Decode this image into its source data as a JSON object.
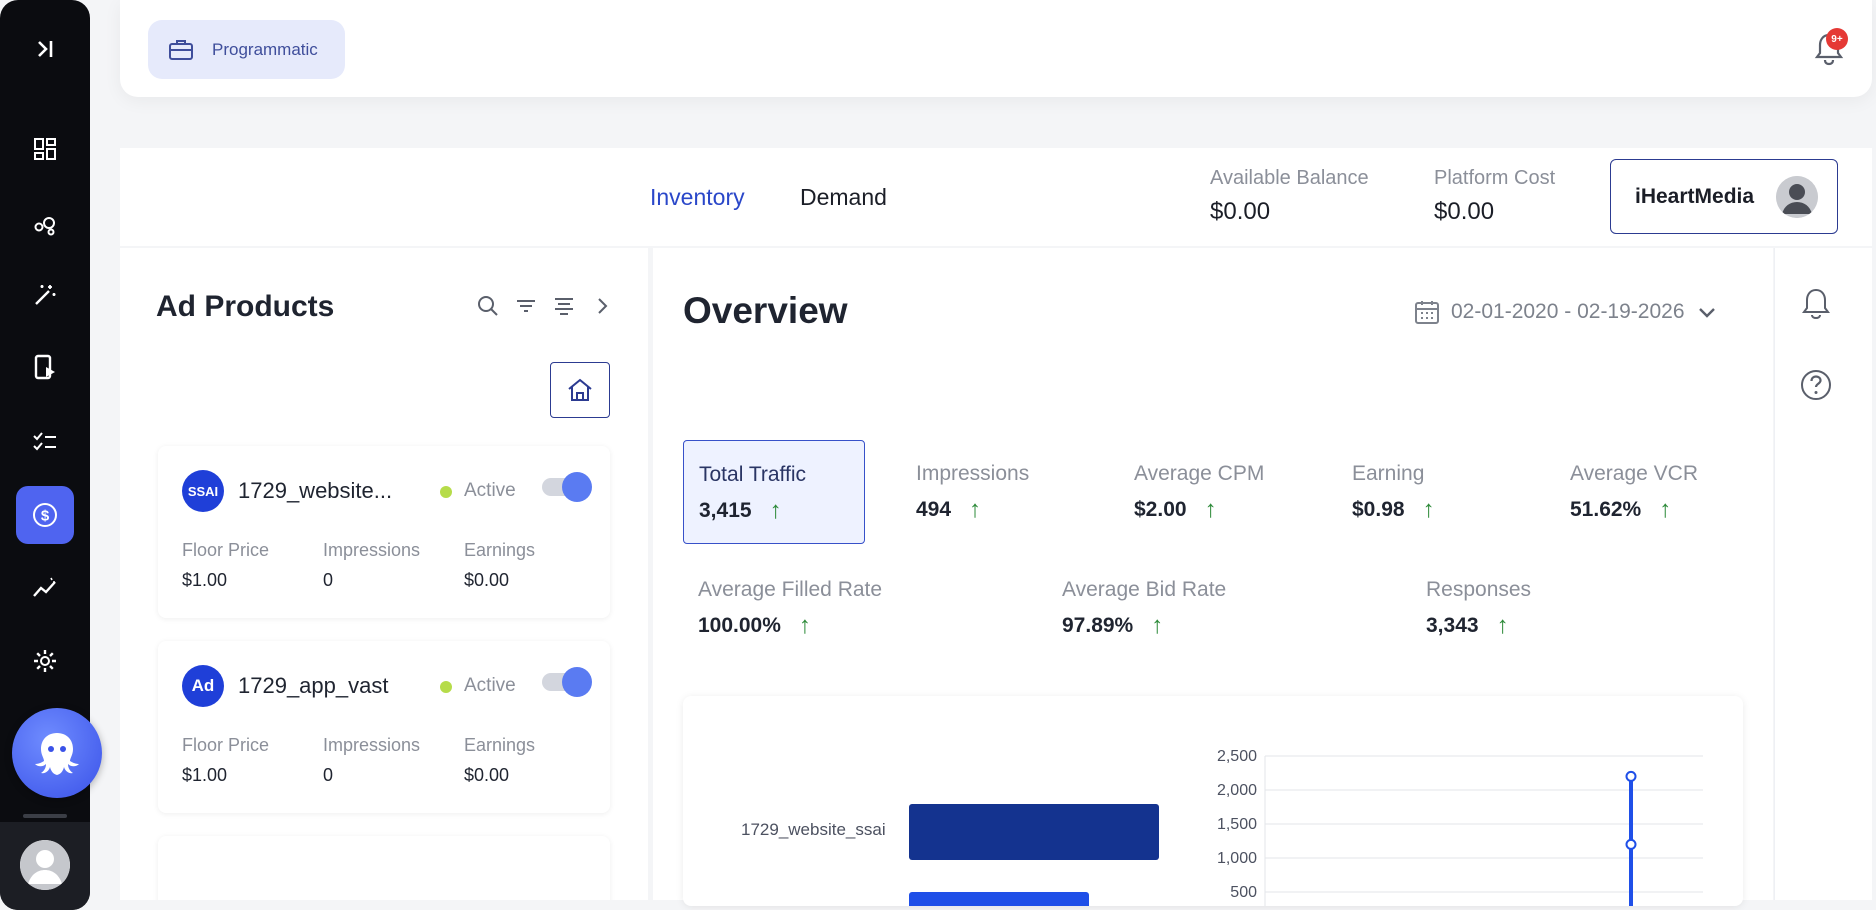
{
  "sidebar": {
    "items": [
      {
        "icon": "dashboard-icon"
      },
      {
        "icon": "bubbles-icon"
      },
      {
        "icon": "magic-wand-icon"
      },
      {
        "icon": "mobile-video-icon"
      },
      {
        "icon": "checklist-icon"
      },
      {
        "icon": "dollar-icon",
        "active": true
      },
      {
        "icon": "trend-icon"
      },
      {
        "icon": "gear-icon"
      }
    ]
  },
  "topbar": {
    "chip_label": "Programmatic",
    "notification_badge": "9+"
  },
  "header": {
    "tabs": [
      {
        "label": "Inventory",
        "active": true
      },
      {
        "label": "Demand",
        "active": false
      }
    ],
    "available_balance": {
      "label": "Available Balance",
      "value": "$0.00"
    },
    "platform_cost": {
      "label": "Platform Cost",
      "value": "$0.00"
    },
    "account_name": "iHeartMedia"
  },
  "ad_products": {
    "title": "Ad Products",
    "cards": [
      {
        "badge": "SSAI",
        "name": "1729_website...",
        "status": "Active",
        "floor_price_label": "Floor Price",
        "floor_price": "$1.00",
        "impressions_label": "Impressions",
        "impressions": "0",
        "earnings_label": "Earnings",
        "earnings": "$0.00"
      },
      {
        "badge": "Ad",
        "name": "1729_app_vast",
        "status": "Active",
        "floor_price_label": "Floor Price",
        "floor_price": "$1.00",
        "impressions_label": "Impressions",
        "impressions": "0",
        "earnings_label": "Earnings",
        "earnings": "$0.00"
      }
    ]
  },
  "overview": {
    "title": "Overview",
    "date_range": "02-01-2020 - 02-19-2026",
    "kpis_row1": [
      {
        "label": "Total Traffic",
        "value": "3,415",
        "arrow": "↑"
      },
      {
        "label": "Impressions",
        "value": "494",
        "arrow": "↑"
      },
      {
        "label": "Average CPM",
        "value": "$2.00",
        "arrow": "↑"
      },
      {
        "label": "Earning",
        "value": "$0.98",
        "arrow": "↑"
      },
      {
        "label": "Average VCR",
        "value": "51.62%",
        "arrow": "↑"
      }
    ],
    "kpis_row2": [
      {
        "label": "Average Filled Rate",
        "value": "100.00%",
        "arrow": "↑"
      },
      {
        "label": "Average Bid Rate",
        "value": "97.89%",
        "arrow": "↑"
      },
      {
        "label": "Responses",
        "value": "3,343",
        "arrow": "↑"
      }
    ]
  },
  "chart_data": [
    {
      "type": "bar",
      "orientation": "horizontal",
      "categories": [
        "1729_website_ssai",
        ""
      ],
      "values": [
        100,
        72
      ],
      "colors": [
        "#14338f",
        "#1f4fe8"
      ],
      "title": "",
      "xlabel": "",
      "ylabel": ""
    },
    {
      "type": "line",
      "yticks": [
        "2,500",
        "2,000",
        "1,500",
        "1,000",
        "500"
      ],
      "ylim": [
        0,
        2500
      ],
      "series": [
        {
          "points_y": [
            2200,
            1200
          ],
          "color": "#1f4fe8"
        }
      ],
      "grid": true
    }
  ]
}
